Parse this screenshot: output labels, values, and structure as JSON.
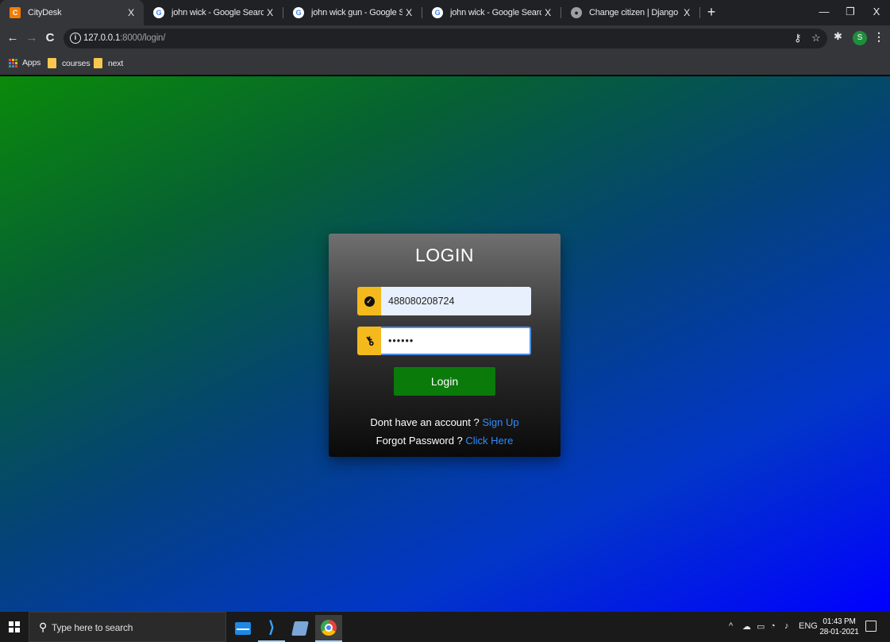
{
  "browser": {
    "tabs": [
      {
        "title": "CityDesk",
        "favicon": "citydesk-icon",
        "active": true
      },
      {
        "title": "john wick - Google Search",
        "favicon": "google-icon"
      },
      {
        "title": "john wick gun - Google Search",
        "favicon": "google-icon"
      },
      {
        "title": "john wick - Google Search",
        "favicon": "google-icon"
      },
      {
        "title": "Change citizen | Django site adm",
        "favicon": "globe-icon"
      }
    ],
    "tab_close": "X",
    "new_tab": "+",
    "window_controls": {
      "minimize": "—",
      "restore": "❐",
      "close": "X"
    },
    "nav": {
      "back": "←",
      "forward": "→",
      "reload": "C"
    },
    "url_host": "127.0.0.1",
    "url_rest": ":8000/login/",
    "profile_initial": "S",
    "bookmarks": [
      {
        "label": "Apps",
        "icon": "apps-grid-icon"
      },
      {
        "label": "courses",
        "icon": "folder-icon"
      },
      {
        "label": "next",
        "icon": "folder-icon"
      }
    ]
  },
  "login": {
    "title": "LOGIN",
    "username_value": "488080208724",
    "password_value": "••••••",
    "button_label": "Login",
    "signup_prompt": "Dont have an account ? ",
    "signup_link": "Sign Up",
    "forgot_prompt": "Forgot Password ? ",
    "forgot_link": "Click Here"
  },
  "colors": {
    "accent_yellow": "#f4b91d",
    "button_green": "#0a7a0a",
    "link_blue": "#2f8cff",
    "bg_gradient_start": "#0a8a0a",
    "bg_gradient_end": "#0000ff"
  },
  "taskbar": {
    "search_placeholder": "Type here to search",
    "apps": [
      "mail-icon",
      "vscode-icon",
      "notes-icon",
      "chrome-icon"
    ],
    "tray_language": "ENG",
    "time": "01:43 PM",
    "date": "28-01-2021"
  }
}
